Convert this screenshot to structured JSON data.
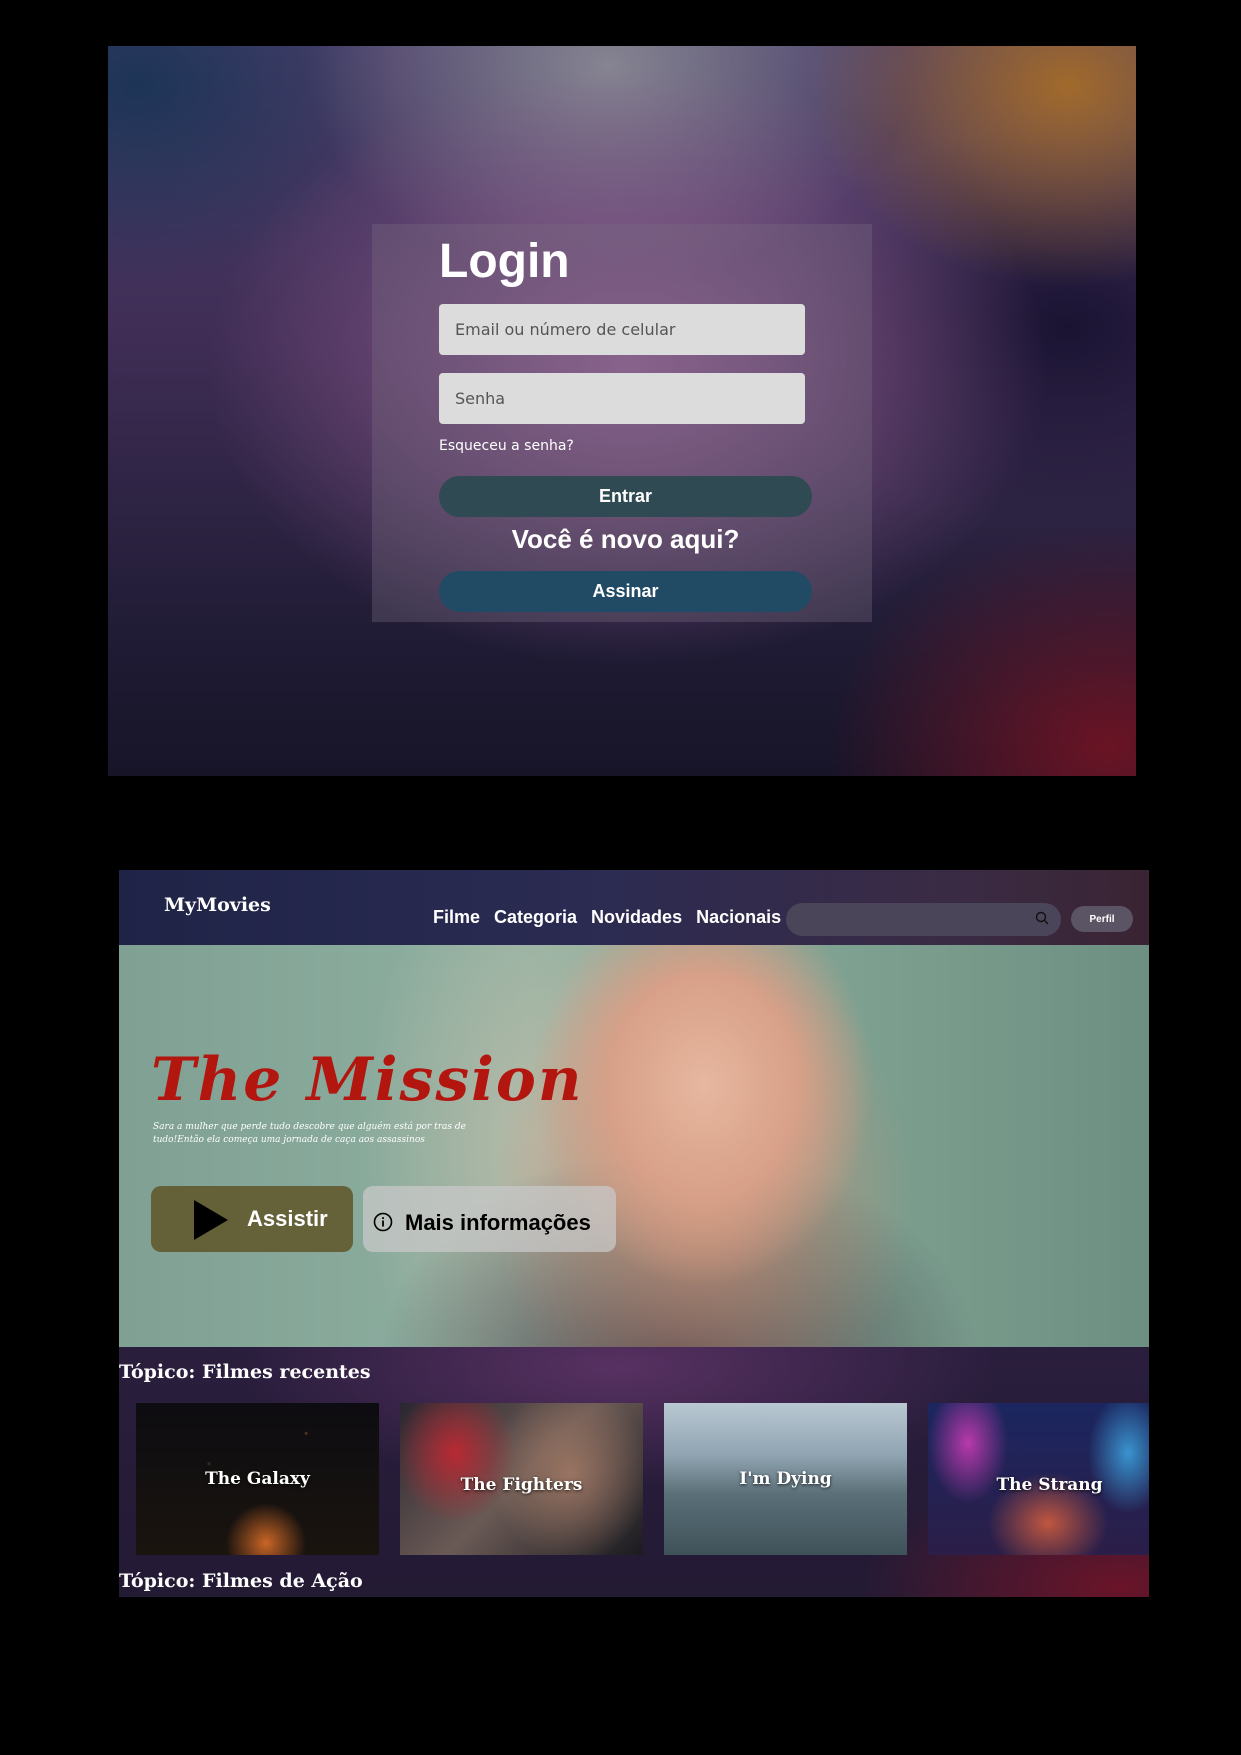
{
  "login": {
    "title": "Login",
    "email_placeholder": "Email ou número de celular",
    "password_placeholder": "Senha",
    "forgot_label": "Esqueceu a senha?",
    "enter_label": "Entrar",
    "new_here_label": "Você é novo aqui?",
    "subscribe_label": "Assinar"
  },
  "home": {
    "logo": "MyMovies",
    "nav": [
      "Filme",
      "Categoria",
      "Novidades",
      "Nacionais"
    ],
    "profile_label": "Perfil",
    "hero": {
      "title": "The  Mission",
      "description": "Sara a mulher que perde tudo descobre que alguém está por tras de tudo!Então ela começa uma jornada de caça aos assassinos",
      "watch_label": "Assistir",
      "info_label": "Mais informações"
    },
    "topics": [
      {
        "title": "Tópico: Filmes recentes",
        "items": [
          "The Galaxy",
          "The Fighters",
          "I'm Dying",
          "The Strang"
        ]
      },
      {
        "title": "Tópico: Filmes de Ação"
      }
    ],
    "colors": {
      "hero_title": "#b3160f",
      "enter_button": "#2f4a52",
      "subscribe_button": "#214a64"
    }
  }
}
